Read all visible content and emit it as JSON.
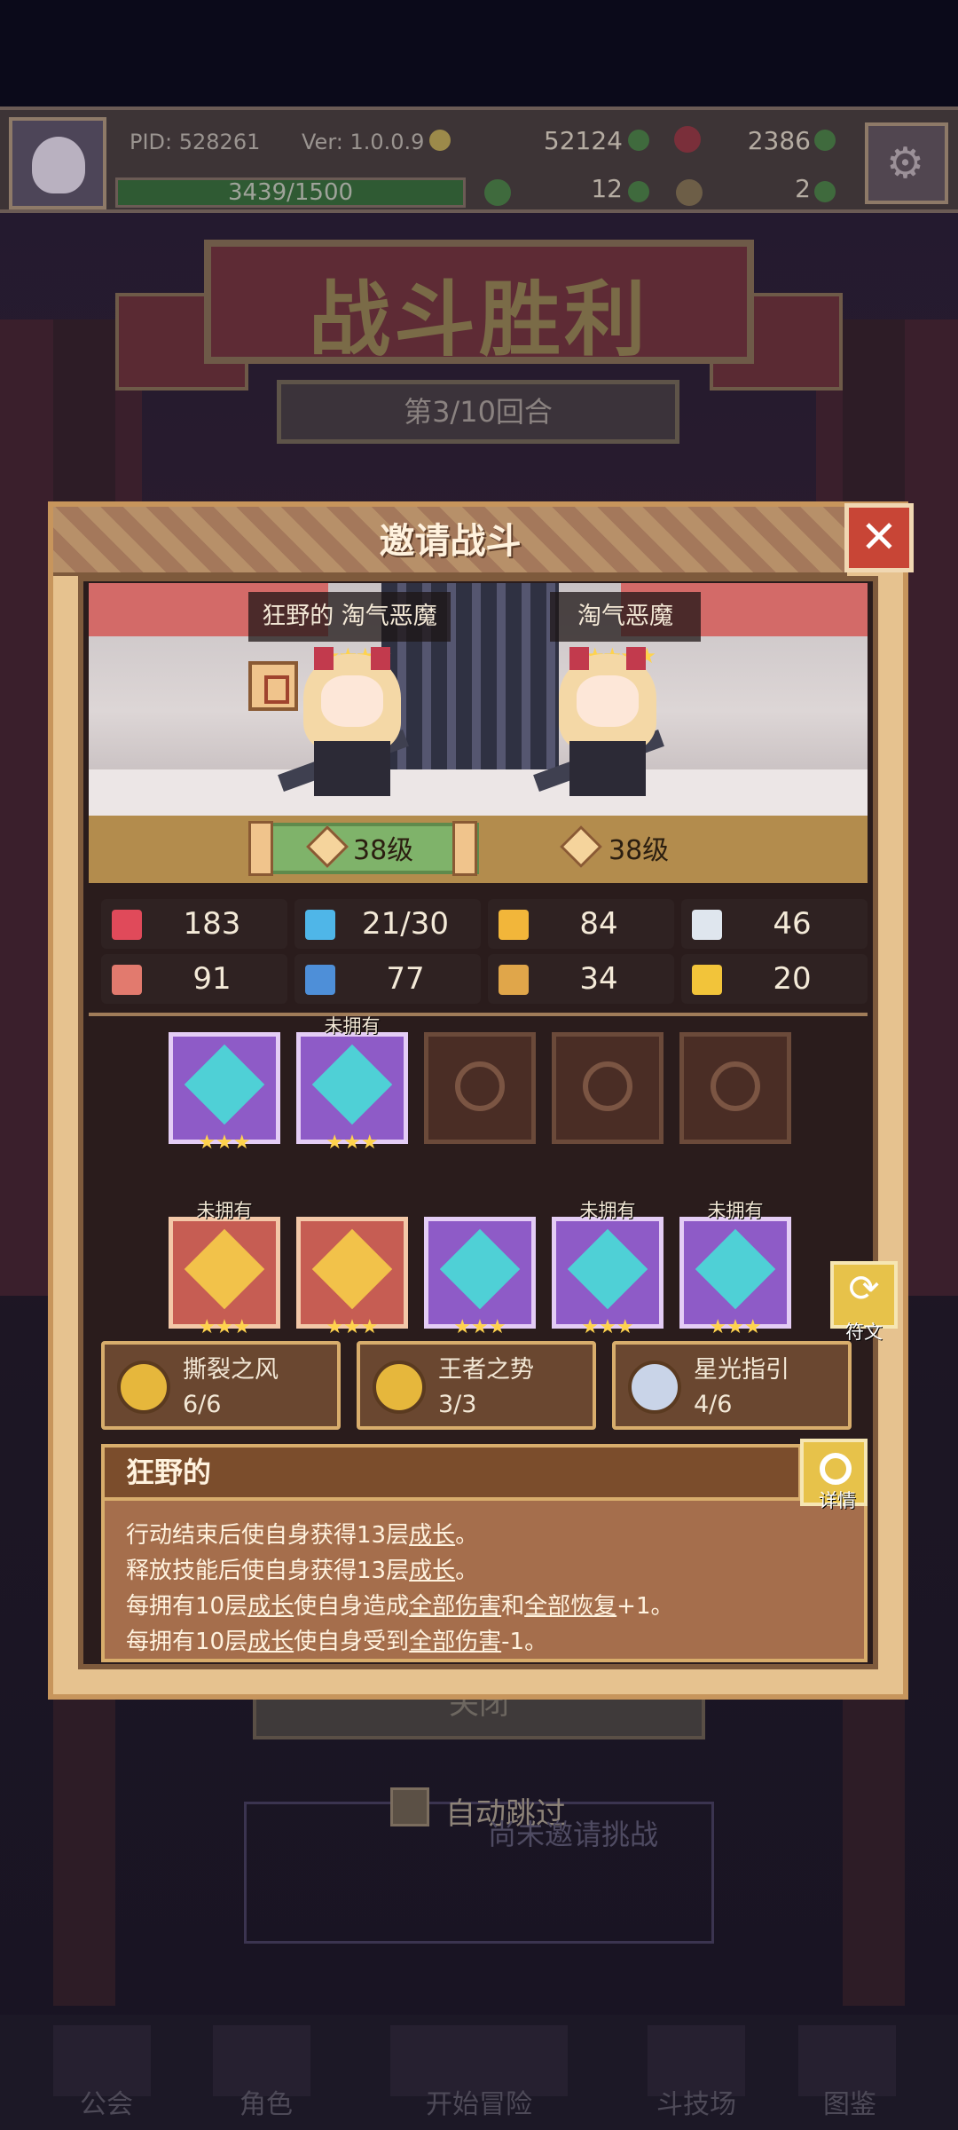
{
  "header": {
    "pid": "PID: 528261",
    "version": "Ver: 1.0.0.9",
    "gold": "52124",
    "gems": "2386",
    "exp_text": "3439/1500",
    "exp_fraction": 1.0,
    "clover": "12",
    "keys": "2",
    "settings_icon": "gear-icon"
  },
  "banner": {
    "title": "战斗胜利",
    "round": "第3/10回合"
  },
  "dialog": {
    "title": "邀请战斗",
    "close_icon": "close-icon",
    "left_unit": {
      "name": "狂野的 淘气恶魔",
      "stars": "★★★★",
      "level": "38级"
    },
    "right_unit": {
      "name": "淘气恶魔",
      "stars": "★★★★",
      "level": "38级"
    },
    "stats": [
      {
        "icon": "heart-icon",
        "value": "183",
        "color": "#e04a5a"
      },
      {
        "icon": "mana-drop-icon",
        "value": "21/30",
        "color": "#4fb6e8"
      },
      {
        "icon": "shield-icon",
        "value": "84",
        "color": "#f2b63a"
      },
      {
        "icon": "wing-icon",
        "value": "46",
        "color": "#dfe6ee"
      },
      {
        "icon": "fist-icon",
        "value": "91",
        "color": "#e27a6e"
      },
      {
        "icon": "book-icon",
        "value": "77",
        "color": "#4e8fd8"
      },
      {
        "icon": "boot-icon",
        "value": "34",
        "color": "#e0a64a"
      },
      {
        "icon": "horseshoe-icon",
        "value": "20",
        "color": "#f2c43a"
      }
    ],
    "equipment_row1": [
      {
        "name": "sword-icon",
        "rarity": "purple",
        "stars": "★★★",
        "tag": ""
      },
      {
        "name": "dagger-icon",
        "rarity": "purple",
        "stars": "★★★",
        "tag": "未拥有"
      },
      {
        "name": "necklace-slot-icon",
        "rarity": "empty",
        "stars": "",
        "tag": ""
      },
      {
        "name": "amulet-slot-icon",
        "rarity": "empty",
        "stars": "",
        "tag": ""
      },
      {
        "name": "ring-slot-icon",
        "rarity": "empty",
        "stars": "",
        "tag": ""
      }
    ],
    "equipment_row2": [
      {
        "name": "straw-hat-icon",
        "rarity": "red",
        "stars": "★★★",
        "tag": "未拥有"
      },
      {
        "name": "armor-icon",
        "rarity": "red",
        "stars": "★★★",
        "tag": ""
      },
      {
        "name": "gauntlet-icon",
        "rarity": "purple",
        "stars": "★★★",
        "tag": ""
      },
      {
        "name": "gem-icon",
        "rarity": "purple",
        "stars": "★★★",
        "tag": "未拥有"
      },
      {
        "name": "boots-icon",
        "rarity": "purple",
        "stars": "★★★",
        "tag": "未拥有"
      }
    ],
    "rune_label": "符文",
    "sets": [
      {
        "name": "撕裂之风",
        "count": "6/6",
        "medal": "gold-medal-icon"
      },
      {
        "name": "王者之势",
        "count": "3/3",
        "medal": "gold-medal-icon"
      },
      {
        "name": "星光指引",
        "count": "4/6",
        "medal": "silver-medal-icon"
      }
    ],
    "trait": {
      "name": "狂野的",
      "detail_label": "详情",
      "lines": [
        [
          {
            "t": "行动结束后使自身获得13层"
          },
          {
            "t": "成长",
            "u": true
          },
          {
            "t": "。"
          }
        ],
        [
          {
            "t": "释放技能后使自身获得13层"
          },
          {
            "t": "成长",
            "u": true
          },
          {
            "t": "。"
          }
        ],
        [
          {
            "t": "每拥有10层"
          },
          {
            "t": "成长",
            "u": true
          },
          {
            "t": "使自身造成"
          },
          {
            "t": "全部伤害",
            "u": true
          },
          {
            "t": "和"
          },
          {
            "t": "全部恢复",
            "u": true
          },
          {
            "t": "+1。"
          }
        ],
        [
          {
            "t": "每拥有10层"
          },
          {
            "t": "成长",
            "u": true
          },
          {
            "t": "使自身受到"
          },
          {
            "t": "全部伤害",
            "u": true
          },
          {
            "t": "-1。"
          }
        ]
      ]
    }
  },
  "background": {
    "close_button": "关闭",
    "auto_skip": "自动跳过",
    "challenge_text": "尚未邀请挑战"
  },
  "nav": {
    "items": [
      "公会",
      "角色",
      "开始冒险",
      "斗技场",
      "图鉴"
    ]
  }
}
